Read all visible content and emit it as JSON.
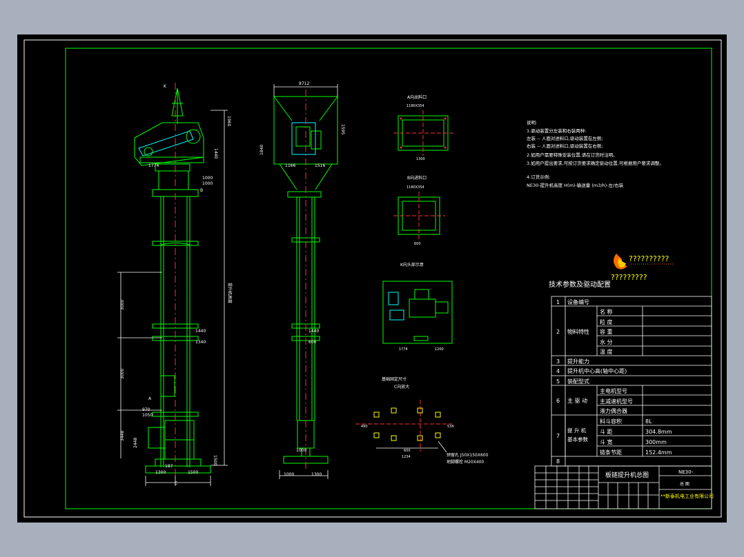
{
  "notes": {
    "heading": "说明:",
    "lines": [
      "1.驱动装置分左装和右装两种:",
      "  左装 -- 人面对进料口,驱动装置在左侧;",
      "  右装 -- 人面对进料口,驱动装置在右侧;",
      "2.如用户需要特殊安装位置,请在订货时注明。",
      "3.如用户提出要求,可按订货要求确定驱动位置,可根据用户要求调整。",
      "4.订货示例:",
      "  NE30-提升机高度 H(m)-输送量 (m3/h)-左/右装"
    ]
  },
  "logo_text": "??????????",
  "logo_sub": "?????????",
  "views": {
    "a_direction": "A向出料口",
    "b_direction": "B向进料口",
    "k_direction": "K向头部示意",
    "foundation_title": "基础固定尺寸",
    "foundation_sub": "C向放大"
  },
  "dims": {
    "top_width": "8712",
    "d1": "1774",
    "d2": "1000",
    "d3": "1440",
    "d4": "1000",
    "d5": "3000",
    "d6": "1440",
    "d7": "1340",
    "d8": "3000",
    "d9": "970",
    "d10": "1050",
    "d11": "1500",
    "d12": "1500",
    "d13": "1300",
    "d14": "187",
    "d15": "3448",
    "d16": "2448",
    "d17": "1166",
    "d18": "1516",
    "d19": "1840",
    "d20": "1300",
    "d21": "600",
    "d22": "1234",
    "d23": "490",
    "d24": "534",
    "d25": "1774",
    "d26": "1200",
    "d27": "1595",
    "d28": "1516",
    "anchor1": "预留孔  J50X150X600",
    "anchor2": "地脚螺栓 M20X400",
    "k_label": "K",
    "b_label": "B",
    "a_label": "A",
    "c_label": "C",
    "head_height": "1960",
    "total_height": "提升机高度",
    "a_size": "1180X354",
    "b_size": "1180X354"
  },
  "table": {
    "title": "技术参数及驱动配置",
    "rows": [
      {
        "no": "1",
        "group": "设备编号",
        "item": "",
        "value": ""
      },
      {
        "no": "2",
        "group": "物料特性",
        "item": "名    称",
        "value": ""
      },
      {
        "no": "",
        "group": "",
        "item": "粒    度",
        "value": ""
      },
      {
        "no": "",
        "group": "",
        "item": "容    重",
        "value": ""
      },
      {
        "no": "",
        "group": "",
        "item": "水    分",
        "value": ""
      },
      {
        "no": "",
        "group": "",
        "item": "温    度",
        "value": ""
      },
      {
        "no": "3",
        "group": "提升能力",
        "item": "",
        "value": ""
      },
      {
        "no": "4",
        "group": "提升机中心高(轴中心距)",
        "item": "",
        "value": ""
      },
      {
        "no": "5",
        "group": "装配型式",
        "item": "",
        "value": ""
      },
      {
        "no": "6",
        "group": "主 驱 动",
        "item": "主电机型号",
        "value": ""
      },
      {
        "no": "",
        "group": "",
        "item": "主减速机型号",
        "value": ""
      },
      {
        "no": "",
        "group": "",
        "item": "液力偶合器",
        "value": ""
      },
      {
        "no": "7",
        "group": "提 升 机 基本参数",
        "item": "料斗容积",
        "value": "8L"
      },
      {
        "no": "",
        "group": "",
        "item": "斗    距",
        "value": "304.8mm"
      },
      {
        "no": "",
        "group": "",
        "item": "斗    宽",
        "value": "300mm"
      },
      {
        "no": "",
        "group": "",
        "item": "链条节距",
        "value": "152.4mm"
      },
      {
        "no": "8",
        "group": "",
        "item": "",
        "value": ""
      }
    ]
  },
  "title_block": {
    "drawing_name": "板链提升机总图",
    "model": "NE30-",
    "sheet": "总 图",
    "company": "**新泰机电工业有限公司"
  },
  "colors": {
    "frame": "#ffffff",
    "border": "#00ff00",
    "machine": "#00ff00",
    "center": "#ff3030",
    "dim": "#ffffff",
    "text_yellow": "#ffff00",
    "accent_cyan": "#00ffff"
  }
}
